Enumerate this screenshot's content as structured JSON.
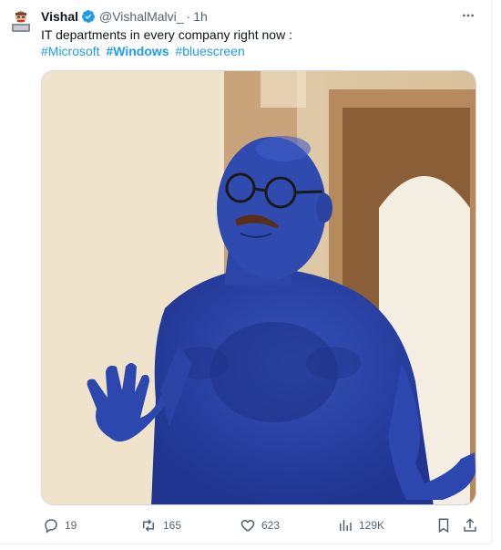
{
  "tweet": {
    "author": {
      "name": "Vishal",
      "handle": "@VishalMalvi_",
      "separator": "·",
      "time": "1h",
      "verified": true,
      "avatar_icon": "avatar-cartoon-icon"
    },
    "text": "IT departments in every company right now :",
    "hashtags": [
      {
        "label": "#Microsoft",
        "bold": false
      },
      {
        "label": "#Windows",
        "bold": true
      },
      {
        "label": "#bluescreen",
        "bold": false
      }
    ],
    "media": {
      "description_icon": "photo-blue-painted-man",
      "accent": "#2d46a8"
    },
    "actions": {
      "replies": "19",
      "retweets": "165",
      "likes": "623",
      "views": "129K"
    }
  },
  "colors": {
    "link": "#1d9bf0",
    "muted": "#536471",
    "text": "#0f1419",
    "verified": "#1d9bf0"
  }
}
